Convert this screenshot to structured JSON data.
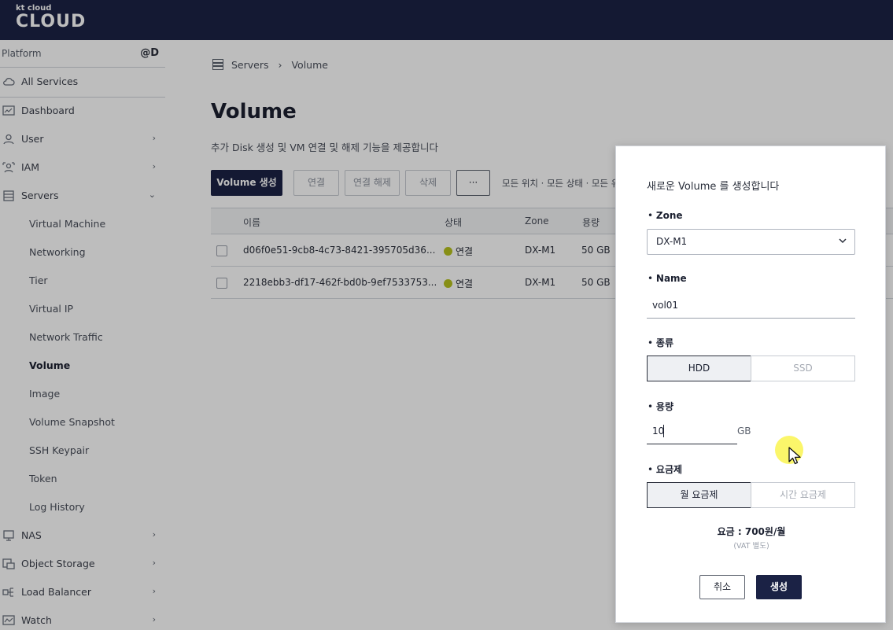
{
  "brand": {
    "small": "kt cloud",
    "big": "CLOUD"
  },
  "sidebar": {
    "platform_label": "Platform",
    "platform_right": "@D",
    "all_services": "All Services",
    "items": [
      {
        "label": "Dashboard",
        "icon": "dashboard-icon",
        "chevron": ""
      },
      {
        "label": "User",
        "icon": "user-icon",
        "chevron": "›"
      },
      {
        "label": "IAM",
        "icon": "iam-icon",
        "chevron": "›"
      },
      {
        "label": "Servers",
        "icon": "servers-icon",
        "chevron": "⌄"
      }
    ],
    "server_sub": [
      "Virtual Machine",
      "Networking",
      "Tier",
      "Virtual IP",
      "Network Traffic",
      "Volume",
      "Image",
      "Volume Snapshot",
      "SSH Keypair",
      "Token",
      "Log History"
    ],
    "bottom": [
      {
        "label": "NAS",
        "icon": "nas-icon",
        "chevron": "›"
      },
      {
        "label": "Object Storage",
        "icon": "object-storage-icon",
        "chevron": "›"
      },
      {
        "label": "Load Balancer",
        "icon": "load-balancer-icon",
        "chevron": "›"
      },
      {
        "label": "Watch",
        "icon": "watch-icon",
        "chevron": "›"
      }
    ]
  },
  "breadcrumb": {
    "parent": "Servers",
    "separator": "›",
    "current": "Volume"
  },
  "main": {
    "title": "Volume",
    "description": "추가 Disk 생성 및 VM 연결 및 해제 기능을 제공합니다",
    "buttons": {
      "create": "Volume 생성",
      "attach": "연결",
      "detach": "연결 해제",
      "delete": "삭제",
      "more": "···"
    },
    "filters": "모든 위치 · 모든 상태 · 모든 유"
  },
  "table": {
    "headers": {
      "name": "이름",
      "status": "상태",
      "zone": "Zone",
      "size": "용량"
    },
    "rows": [
      {
        "name": "d06f0e51-9cb8-4c73-8421-395705d36...",
        "status": "연결",
        "zone": "DX-M1",
        "size": "50 GB"
      },
      {
        "name": "2218ebb3-df17-462f-bd0b-9ef7533753...",
        "status": "연결",
        "zone": "DX-M1",
        "size": "50 GB"
      }
    ]
  },
  "modal": {
    "title": "새로운 Volume 를 생성합니다",
    "zone_label": "Zone",
    "zone_value": "DX-M1",
    "name_label": "Name",
    "name_value": "vol01",
    "type_label": "종류",
    "type_options": [
      "HDD",
      "SSD"
    ],
    "type_selected": "HDD",
    "capacity_label": "용량",
    "capacity_value": "10",
    "capacity_unit": "GB",
    "plan_label": "요금제",
    "plan_options": [
      "월 요금제",
      "시간 요금제"
    ],
    "plan_selected": "월 요금제",
    "fee": "요금 : 700원/월",
    "vat": "(VAT 별도)",
    "cancel": "취소",
    "create": "생성"
  },
  "colors": {
    "navy": "#1b2245",
    "status_dot": "#b6c21e",
    "cursor_highlight": "#faf450"
  }
}
